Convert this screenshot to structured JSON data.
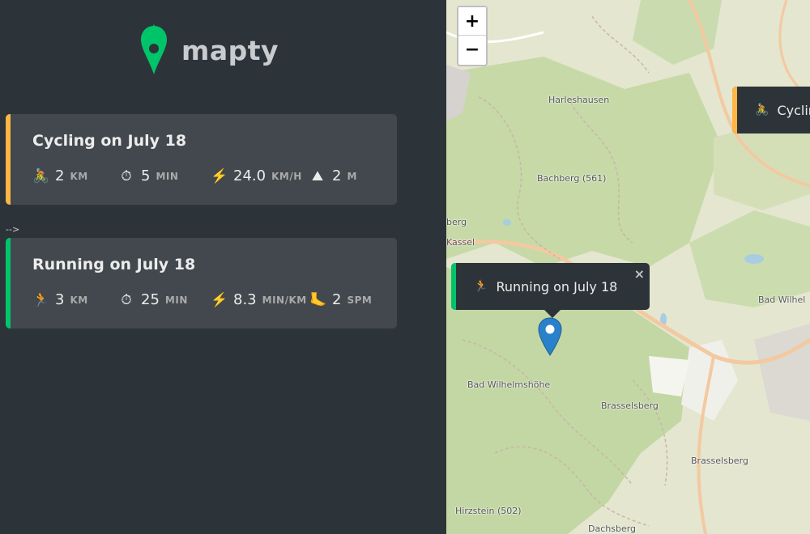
{
  "app": {
    "logo_text": "mapty"
  },
  "workouts": [
    {
      "type": "cycling",
      "title": "Cycling on July 18",
      "details": [
        {
          "icon": "🚴",
          "icon_name": "cyclist-icon",
          "value": "2",
          "unit": "km"
        },
        {
          "icon": "⏱",
          "icon_name": "stopwatch-icon",
          "value": "5",
          "unit": "min"
        },
        {
          "icon": "⚡️",
          "icon_name": "lightning-icon",
          "value": "24.0",
          "unit": "km/h"
        },
        {
          "icon": "⛰",
          "icon_name": "mountain-icon",
          "value": "2",
          "unit": "m"
        }
      ]
    },
    {
      "type": "running",
      "title": "Running on July 18",
      "details": [
        {
          "icon": "🏃",
          "icon_name": "runner-icon",
          "value": "3",
          "unit": "km"
        },
        {
          "icon": "⏱",
          "icon_name": "stopwatch-icon",
          "value": "25",
          "unit": "min"
        },
        {
          "icon": "⚡️",
          "icon_name": "lightning-icon",
          "value": "8.3",
          "unit": "min/km"
        },
        {
          "icon": "🦶",
          "icon_name": "foot-icon",
          "value": "2",
          "unit": "spm"
        }
      ]
    }
  ],
  "stray_text": "-->",
  "map": {
    "zoom_in": "+",
    "zoom_out": "−",
    "popups": {
      "running": {
        "icon": "🏃",
        "text": "Running on July 18",
        "close": "×"
      },
      "cycling": {
        "icon": "🚴",
        "text": "Cyclin"
      }
    },
    "labels": {
      "harleshausen": "Harleshausen",
      "bachberg": "Bachberg (561)",
      "kassel": "Kassel",
      "berg": "berg",
      "bad_wilhelmshoehe": "Bad Wilhelmshöhe",
      "bad_wilhel": "Bad Wilhel",
      "brasselsberg": "Brasselsberg",
      "brasselsberg2": "Brasselsberg",
      "hirzstein": "Hirzstein (502)",
      "dachsberg": "Dachsberg"
    }
  },
  "colors": {
    "cycling": "#ffb545",
    "running": "#00c46a",
    "sidebar_bg": "#2d3439",
    "card_bg": "#42484d"
  }
}
